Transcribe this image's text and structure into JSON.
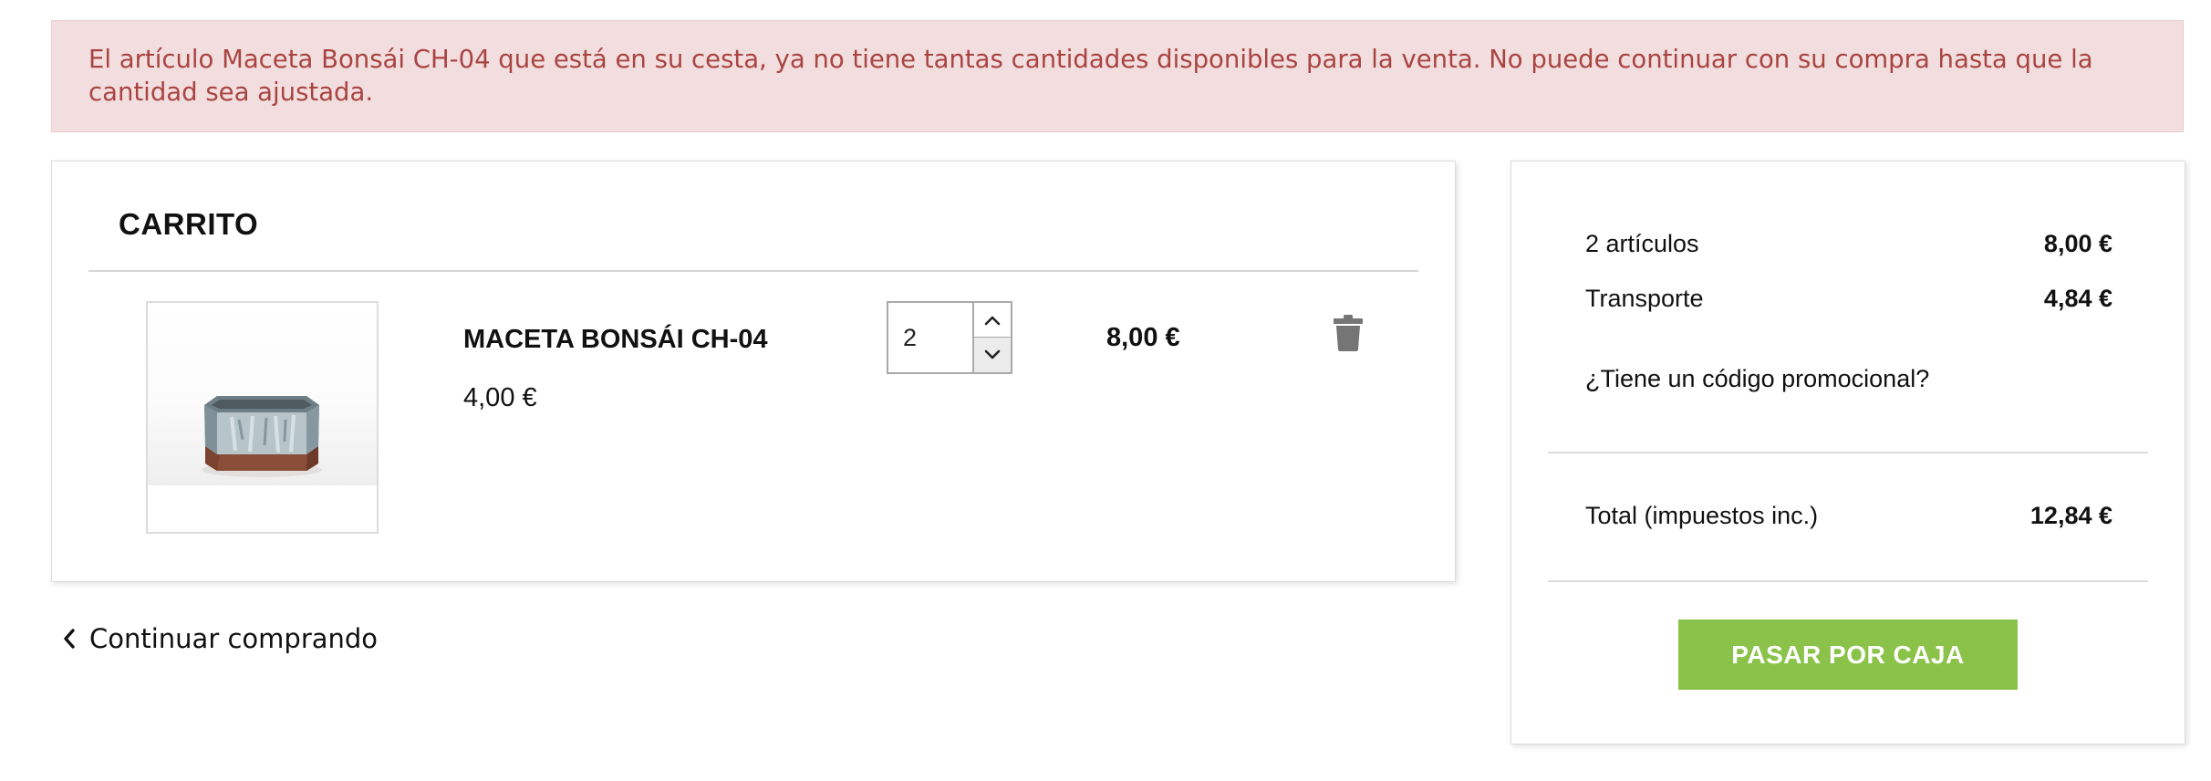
{
  "alert": {
    "message": "El artículo Maceta Bonsái CH-04 que está en su cesta, ya no tiene tantas cantidades disponibles para la venta. No puede continuar con su compra hasta que la cantidad sea ajustada.",
    "color": "#a94442",
    "background": "#f2dede"
  },
  "cart": {
    "title": "CARRITO",
    "items": [
      {
        "name": "MACETA BONSÁI CH-04",
        "unit_price": "4,00 €",
        "quantity": "2",
        "line_total": "8,00 €",
        "image_icon": "bonsai-pot-image",
        "delete_icon": "trash-icon"
      }
    ],
    "continue_label": "Continuar comprando"
  },
  "summary": {
    "items_label": "2 artículos",
    "items_value": "8,00 €",
    "shipping_label": "Transporte",
    "shipping_value": "4,84 €",
    "promo_label": "¿Tiene un código promocional?",
    "total_label": "Total (impuestos inc.)",
    "total_value": "12,84 €",
    "checkout_label": "PASAR POR CAJA",
    "checkout_color": "#8bc34a"
  }
}
